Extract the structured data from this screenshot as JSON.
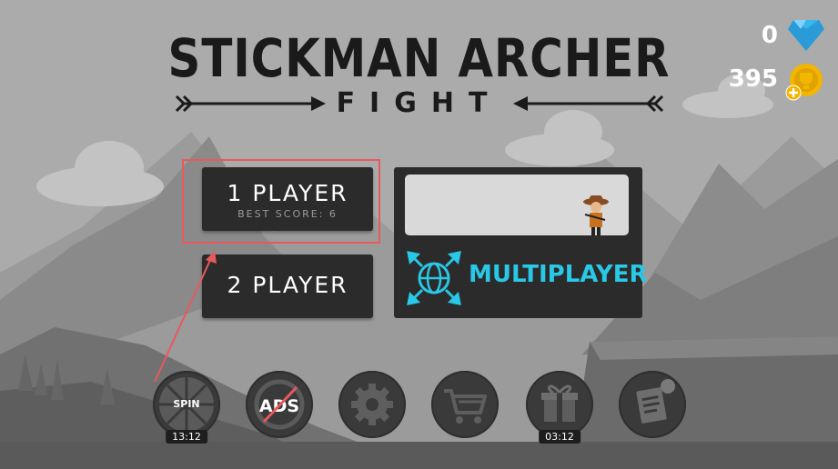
{
  "title": {
    "main": "STICKMAN ARCHER",
    "sub": "FIGHT"
  },
  "currency": {
    "gems": "0",
    "coins": "395",
    "gem_color": "#38b6f0",
    "coin_color": "#f2b500"
  },
  "menu": {
    "one_player": {
      "label": "1 PLAYER",
      "best_score": "BEST SCORE: 6"
    },
    "two_player": {
      "label": "2 PLAYER"
    },
    "multiplayer": {
      "label": "MULTIPLAYER",
      "accent": "#29c8e6"
    }
  },
  "bottom_bar": {
    "spin": {
      "label": "SPIN",
      "timer": "13:12",
      "icon": "spin-wheel-icon"
    },
    "no_ads": {
      "label": "ADS",
      "icon": "no-ads-icon"
    },
    "settings": {
      "icon": "gear-icon"
    },
    "shop": {
      "icon": "cart-icon"
    },
    "gift": {
      "timer": "03:12",
      "icon": "gift-icon"
    },
    "news": {
      "icon": "notes-icon"
    }
  },
  "annotation": {
    "highlight_color": "#e8595c"
  }
}
